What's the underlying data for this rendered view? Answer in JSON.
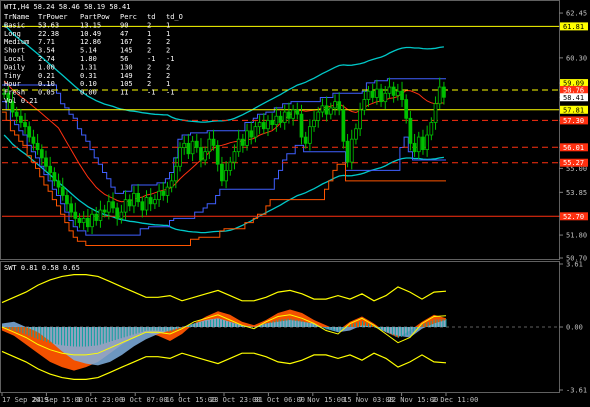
{
  "window": {
    "symbol_line": "WTI,H4 58.24 58.46 58.19 58.41",
    "indicator_line": "SWT 0.81 0.58 0.65"
  },
  "table": {
    "headers": [
      "TrName",
      "TrPower",
      "PartPow",
      "Perc",
      "td",
      "td_O"
    ],
    "rows": [
      [
        "Basic",
        "53.63",
        "13.15",
        "90",
        "2",
        "1"
      ],
      [
        "Long",
        "22.38",
        "10.49",
        "47",
        "1",
        "1"
      ],
      [
        "Medium",
        "7.71",
        "12.86",
        "167",
        "2",
        "2"
      ],
      [
        "Short",
        "3.54",
        "5.14",
        "145",
        "2",
        "2"
      ],
      [
        "Local",
        "2.74",
        "1.80",
        "56",
        "-1",
        "-1"
      ],
      [
        "Daily",
        "1.00",
        "1.31",
        "130",
        "2",
        "2"
      ],
      [
        "Tiny",
        "0.21",
        "0.31",
        "149",
        "2",
        "2"
      ],
      [
        "Hour",
        "0.10",
        "0.10",
        "105",
        "2",
        "1"
      ],
      [
        "Fresh",
        "0.05",
        "0.00",
        "11",
        "-1",
        "-1"
      ]
    ],
    "footer": "Vol 0.21"
  },
  "colors": {
    "background": "#000000",
    "bull": "#00c000",
    "bear": "#00c000",
    "yellow": "#ffff00",
    "cyan": "#00c8c8",
    "blue": "#4060ff",
    "red": "#ff3010",
    "orange": "#ff5500",
    "lightblue": "#80b0e0",
    "teal": "#10a0a0"
  },
  "chart_data": [
    {
      "type": "candlestick",
      "title": "WTI,H4",
      "ylim": [
        50.7,
        62.5
      ],
      "y_ticks": [
        "62.45",
        "61.81",
        "60.30",
        "59.09",
        "58.76",
        "58.41",
        "57.81",
        "57.30",
        "56.01",
        "55.27",
        "55.00",
        "53.85",
        "52.70",
        "51.80",
        "50.70"
      ],
      "price_labels": [
        {
          "value": "61.81",
          "color": "#ffff00"
        },
        {
          "value": "59.09",
          "color": "#ffff00"
        },
        {
          "value": "58.76",
          "color": "#ff3010"
        },
        {
          "value": "58.41",
          "color": "#ffffff"
        },
        {
          "value": "57.81",
          "color": "#ffff00"
        },
        {
          "value": "57.30",
          "color": "#ff3010"
        },
        {
          "value": "56.01",
          "color": "#ff3010"
        },
        {
          "value": "55.27",
          "color": "#ff3010"
        },
        {
          "value": "52.70",
          "color": "#ff3010"
        }
      ],
      "horizontal_lines": [
        {
          "value": 61.81,
          "color": "#ffff00",
          "style": "solid"
        },
        {
          "value": 58.76,
          "color": "#ffff00",
          "style": "dashed"
        },
        {
          "value": 57.81,
          "color": "#ffff00",
          "style": "solid"
        },
        {
          "value": 57.3,
          "color": "#ff3010",
          "style": "dashed"
        },
        {
          "value": 56.01,
          "color": "#ff3010",
          "style": "dashed"
        },
        {
          "value": 55.27,
          "color": "#ff3010",
          "style": "dashed"
        },
        {
          "value": 52.7,
          "color": "#ff3010",
          "style": "solid"
        }
      ],
      "close": [
        58.6,
        58.2,
        57.7,
        57.5,
        57.2,
        57.0,
        56.5,
        56.2,
        55.9,
        55.5,
        55.1,
        54.8,
        54.4,
        54.1,
        53.7,
        53.3,
        52.9,
        52.6,
        52.4,
        52.6,
        52.2,
        52.8,
        52.5,
        53.0,
        52.9,
        53.4,
        53.1,
        52.6,
        52.9,
        53.5,
        53.2,
        53.8,
        53.4,
        53.0,
        53.6,
        53.3,
        53.5,
        53.9,
        53.7,
        54.1,
        54.4,
        55.1,
        56.0,
        56.2,
        55.7,
        56.3,
        56.0,
        55.4,
        55.8,
        56.4,
        56.1,
        55.2,
        54.4,
        54.9,
        55.3,
        55.8,
        56.4,
        56.1,
        56.8,
        56.5,
        57.0,
        57.2,
        56.9,
        57.3,
        57.1,
        57.5,
        57.2,
        57.7,
        57.4,
        57.8,
        57.6,
        56.5,
        56.2,
        57.0,
        57.3,
        57.7,
        58.0,
        57.6,
        57.9,
        58.2,
        57.8,
        56.3,
        55.3,
        56.4,
        56.9,
        57.8,
        58.3,
        58.7,
        58.4,
        58.8,
        58.2,
        58.6,
        58.9,
        58.5,
        58.7,
        58.3,
        57.4,
        56.2,
        55.8,
        56.5,
        55.9,
        56.6,
        57.2,
        58.1,
        58.9,
        58.41
      ],
      "x_labels": [
        "17 Sep 2019",
        "24 Sep 15:00",
        "1 Oct 23:00",
        "9 Oct 07:00",
        "16 Oct 15:00",
        "23 Oct 23:00",
        "31 Oct 06:00",
        "7 Nov 15:00",
        "15 Nov 03:00",
        "22 Nov 15:00",
        "2 Dec 11:00"
      ]
    },
    {
      "type": "area",
      "title": "SWT 0.81 0.58 0.65",
      "ylim": [
        -3.61,
        3.61
      ],
      "y_ticks": [
        "3.61",
        "0.00",
        "-3.61"
      ],
      "series": [
        {
          "values": [
            -0.2,
            -0.5,
            -1.0,
            -1.5,
            -2.0,
            -2.3,
            -2.5,
            -2.3,
            -2.0,
            -1.5,
            -1.0,
            -0.6,
            -0.3,
            -0.5,
            -0.8,
            -0.4,
            0.2,
            0.6,
            0.9,
            0.7,
            0.3,
            0.1,
            0.4,
            0.8,
            1.0,
            0.8,
            0.4,
            0.1,
            -0.2,
            0.3,
            0.6,
            0.2,
            -0.3,
            -0.6,
            -0.2,
            0.3,
            0.7,
            0.5
          ]
        },
        {
          "values": [
            0.2,
            0.3,
            0.0,
            -0.3,
            -0.8,
            -1.4,
            -1.9,
            -2.1,
            -2.2,
            -2.0,
            -1.6,
            -1.1,
            -0.7,
            -0.4,
            -0.2,
            0.0,
            0.2,
            0.4,
            0.5,
            0.3,
            0.1,
            0.0,
            0.2,
            0.3,
            0.4,
            0.3,
            0.2,
            -0.1,
            -0.3,
            -0.2,
            0.1,
            0.0,
            -0.3,
            -0.5,
            -0.6,
            -0.1,
            0.2,
            0.4
          ]
        },
        {
          "values": [
            0.0,
            -0.3,
            -0.6,
            -1.0,
            -1.3,
            -1.5,
            -1.6,
            -1.6,
            -1.5,
            -1.2,
            -0.9,
            -0.6,
            -0.3,
            -0.3,
            -0.4,
            -0.1,
            0.3,
            0.5,
            0.7,
            0.4,
            0.1,
            -0.1,
            0.3,
            0.6,
            0.7,
            0.5,
            0.2,
            -0.2,
            -0.4,
            0.2,
            0.5,
            0.1,
            -0.4,
            -0.9,
            -0.6,
            0.2,
            0.6,
            0.65
          ]
        }
      ],
      "x_labels": [
        "17 Sep 2019",
        "24 Sep 15:00",
        "1 Oct 23:00",
        "9 Oct 07:00",
        "16 Oct 15:00",
        "23 Oct 23:00",
        "31 Oct 06:00",
        "7 Nov 15:00",
        "15 Nov 03:00",
        "22 Nov 15:00",
        "2 Dec 11:00"
      ]
    }
  ]
}
